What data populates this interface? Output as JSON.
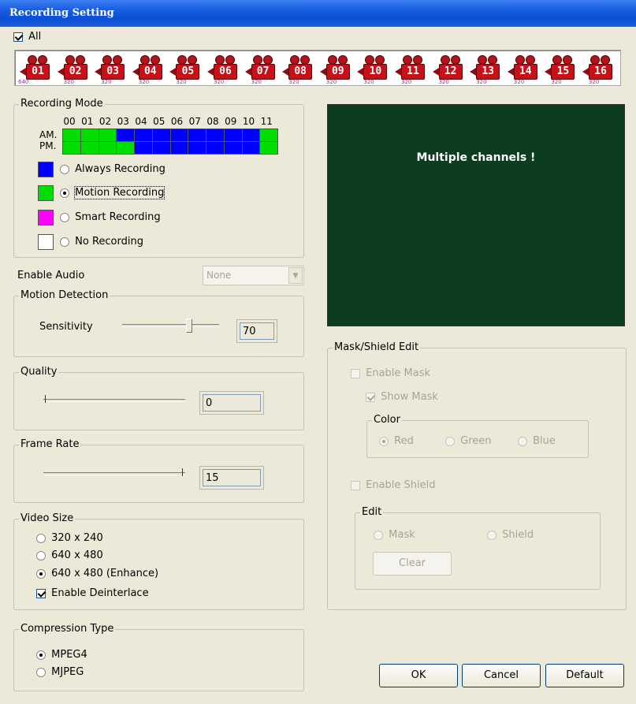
{
  "window": {
    "title": "Recording Setting"
  },
  "all_checkbox": {
    "label": "All",
    "checked": true
  },
  "channels": [
    {
      "num": "01",
      "res": "640"
    },
    {
      "num": "02",
      "res": "320"
    },
    {
      "num": "03",
      "res": "320"
    },
    {
      "num": "04",
      "res": "320"
    },
    {
      "num": "05",
      "res": "320"
    },
    {
      "num": "06",
      "res": "320"
    },
    {
      "num": "07",
      "res": "320"
    },
    {
      "num": "08",
      "res": "320"
    },
    {
      "num": "09",
      "res": "320"
    },
    {
      "num": "10",
      "res": "320"
    },
    {
      "num": "11",
      "res": "320"
    },
    {
      "num": "12",
      "res": "320"
    },
    {
      "num": "13",
      "res": "320"
    },
    {
      "num": "14",
      "res": "320"
    },
    {
      "num": "15",
      "res": "320"
    },
    {
      "num": "16",
      "res": "320"
    }
  ],
  "recording_mode": {
    "title": "Recording Mode",
    "hours": [
      "00",
      "01",
      "02",
      "03",
      "04",
      "05",
      "06",
      "07",
      "08",
      "09",
      "10",
      "11"
    ],
    "am_label": "AM.",
    "pm_label": "PM.",
    "schedule_am": [
      "motion",
      "motion",
      "motion",
      "always",
      "always",
      "always",
      "always",
      "always",
      "always",
      "always",
      "always",
      "motion"
    ],
    "schedule_pm": [
      "motion",
      "motion",
      "motion",
      "motion",
      "always",
      "always",
      "always",
      "always",
      "always",
      "always",
      "always",
      "motion"
    ],
    "options": [
      {
        "label": "Always Recording",
        "color": "#0000ff",
        "checked": false
      },
      {
        "label": "Motion Recording",
        "color": "#00dd00",
        "checked": true
      },
      {
        "label": "Smart Recording",
        "color": "#ff00ff",
        "checked": false
      },
      {
        "label": "No Recording",
        "color": "#ffffff",
        "checked": false
      }
    ]
  },
  "colors": {
    "always": "#0000ff",
    "motion": "#00dd00",
    "smart": "#ff00ff",
    "none": "#ffffff"
  },
  "enable_audio": {
    "label": "Enable Audio",
    "value": "None"
  },
  "motion_detection": {
    "title": "Motion Detection",
    "sensitivity_label": "Sensitivity",
    "value": "70",
    "slider_level": 0.7
  },
  "quality": {
    "title": "Quality",
    "value": "0",
    "slider_level": 0.0
  },
  "frame_rate": {
    "title": "Frame Rate",
    "value": "15",
    "slider_level": 1.0
  },
  "video_size": {
    "title": "Video Size",
    "options": [
      {
        "label": "320 x 240",
        "checked": false
      },
      {
        "label": "640 x 480",
        "checked": false
      },
      {
        "label": "640 x 480 (Enhance)",
        "checked": true
      }
    ],
    "deinterlace": {
      "label": "Enable Deinterlace",
      "checked": true
    }
  },
  "compression": {
    "title": "Compression Type",
    "options": [
      {
        "label": "MPEG4",
        "checked": true
      },
      {
        "label": "MJPEG",
        "checked": false
      }
    ]
  },
  "preview": {
    "text": "Multiple channels !"
  },
  "mask_shield": {
    "title": "Mask/Shield Edit",
    "enable_mask": "Enable Mask",
    "show_mask": "Show Mask",
    "color_title": "Color",
    "colors": [
      "Red",
      "Green",
      "Blue"
    ],
    "enable_shield": "Enable Shield",
    "edit_title": "Edit",
    "edit_options": [
      "Mask",
      "Shield"
    ],
    "clear_label": "Clear"
  },
  "buttons": {
    "ok": "OK",
    "cancel": "Cancel",
    "default": "Default"
  }
}
